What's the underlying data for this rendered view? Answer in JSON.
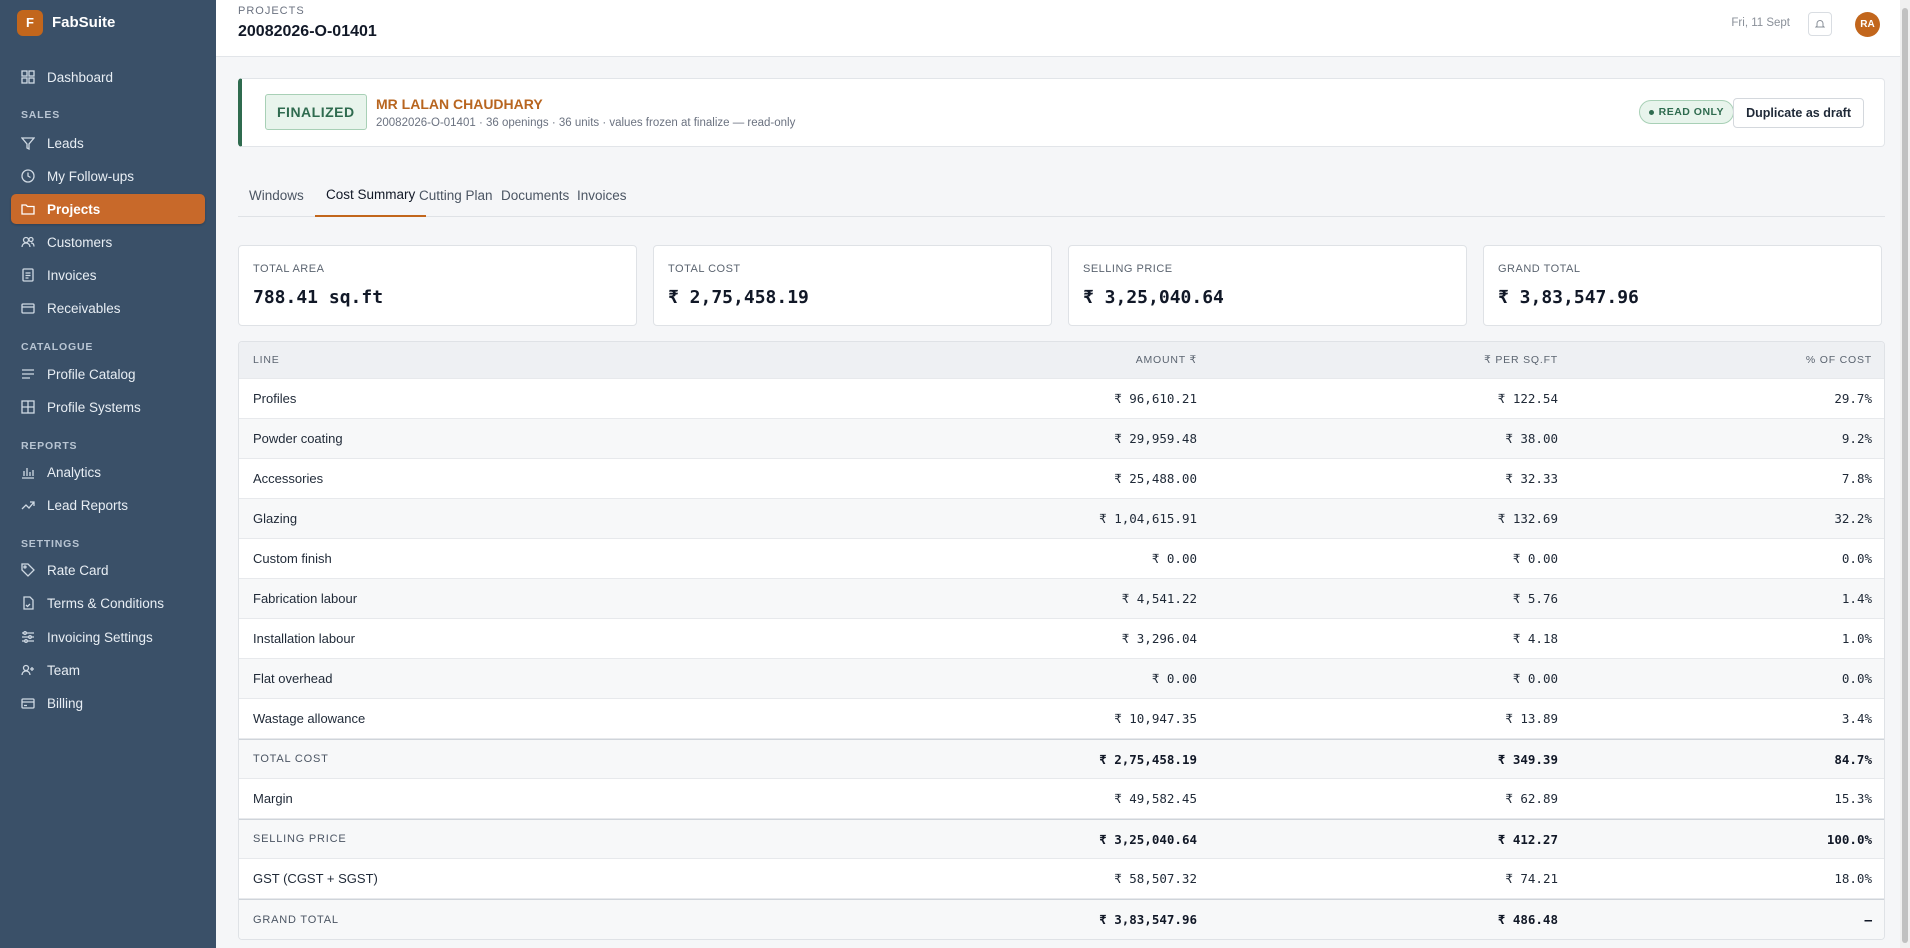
{
  "brand": {
    "initial": "F",
    "name": "FabSuite"
  },
  "sidebar": {
    "items": [
      {
        "label": "Dashboard",
        "icon": "grid-icon"
      },
      {
        "label": "Leads",
        "icon": "filter-icon"
      },
      {
        "label": "My Follow-ups",
        "icon": "clock-icon"
      },
      {
        "label": "Projects",
        "icon": "folder-icon"
      },
      {
        "label": "Customers",
        "icon": "users-icon"
      },
      {
        "label": "Invoices",
        "icon": "document-icon"
      },
      {
        "label": "Receivables",
        "icon": "wallet-icon"
      },
      {
        "label": "Profile Catalog",
        "icon": "stack-icon"
      },
      {
        "label": "Profile Systems",
        "icon": "window-icon"
      },
      {
        "label": "Analytics",
        "icon": "bar-chart-icon"
      },
      {
        "label": "Lead Reports",
        "icon": "trend-icon"
      },
      {
        "label": "Rate Card",
        "icon": "tag-icon"
      },
      {
        "label": "Terms & Conditions",
        "icon": "doc-sign-icon"
      },
      {
        "label": "Invoicing Settings",
        "icon": "sliders-icon"
      },
      {
        "label": "Team",
        "icon": "user-plus-icon"
      },
      {
        "label": "Billing",
        "icon": "card-icon"
      }
    ],
    "sections": [
      "SALES",
      "CATALOGUE",
      "REPORTS",
      "SETTINGS"
    ]
  },
  "header": {
    "breadcrumb": "PROJECTS",
    "title": "20082026-O-01401",
    "date": "Fri, 11 Sept",
    "avatar": "RA"
  },
  "banner": {
    "status": "FINALIZED",
    "client": "MR LALAN CHAUDHARY",
    "subtitle": "20082026-O-01401 · 36 openings · 36 units · values frozen at finalize — read-only",
    "badge": "READ ONLY",
    "duplicate_label": "Duplicate as draft"
  },
  "tabs": [
    "Windows",
    "Cost Summary",
    "Cutting Plan",
    "Documents",
    "Invoices"
  ],
  "active_tab": "Cost Summary",
  "kpis": [
    {
      "label": "TOTAL AREA",
      "value": "788.41 sq.ft"
    },
    {
      "label": "TOTAL COST",
      "value": "₹ 2,75,458.19"
    },
    {
      "label": "SELLING PRICE",
      "value": "₹ 3,25,040.64"
    },
    {
      "label": "GRAND TOTAL",
      "value": "₹ 3,83,547.96"
    }
  ],
  "table": {
    "headers": {
      "line": "LINE",
      "amount": "AMOUNT ₹",
      "per_sqft": "₹ PER SQ.FT",
      "pct": "% OF COST"
    },
    "rows": [
      {
        "line": "Profiles",
        "amount": "₹ 96,610.21",
        "per_sqft": "₹ 122.54",
        "pct": "29.7%"
      },
      {
        "line": "Powder coating",
        "amount": "₹ 29,959.48",
        "per_sqft": "₹ 38.00",
        "pct": "9.2%"
      },
      {
        "line": "Accessories",
        "amount": "₹ 25,488.00",
        "per_sqft": "₹ 32.33",
        "pct": "7.8%"
      },
      {
        "line": "Glazing",
        "amount": "₹ 1,04,615.91",
        "per_sqft": "₹ 132.69",
        "pct": "32.2%"
      },
      {
        "line": "Custom finish",
        "amount": "₹ 0.00",
        "per_sqft": "₹ 0.00",
        "pct": "0.0%"
      },
      {
        "line": "Fabrication labour",
        "amount": "₹ 4,541.22",
        "per_sqft": "₹ 5.76",
        "pct": "1.4%"
      },
      {
        "line": "Installation labour",
        "amount": "₹ 3,296.04",
        "per_sqft": "₹ 4.18",
        "pct": "1.0%"
      },
      {
        "line": "Flat overhead",
        "amount": "₹ 0.00",
        "per_sqft": "₹ 0.00",
        "pct": "0.0%"
      },
      {
        "line": "Wastage allowance",
        "amount": "₹ 10,947.35",
        "per_sqft": "₹ 13.89",
        "pct": "3.4%"
      },
      {
        "line": "TOTAL COST",
        "amount": "₹ 2,75,458.19",
        "per_sqft": "₹ 349.39",
        "pct": "84.7%",
        "total": true
      },
      {
        "line": "Margin",
        "amount": "₹ 49,582.45",
        "per_sqft": "₹ 62.89",
        "pct": "15.3%"
      },
      {
        "line": "SELLING PRICE",
        "amount": "₹ 3,25,040.64",
        "per_sqft": "₹ 412.27",
        "pct": "100.0%",
        "total": true
      },
      {
        "line": "GST (CGST + SGST)",
        "amount": "₹ 58,507.32",
        "per_sqft": "₹ 74.21",
        "pct": "18.0%"
      },
      {
        "line": "GRAND TOTAL",
        "amount": "₹ 3,83,547.96",
        "per_sqft": "₹ 486.48",
        "pct": "–",
        "total": true
      }
    ]
  },
  "colors": {
    "sidebar": "#3a5068",
    "accent": "#c2661c",
    "success": "#2f6b4f"
  }
}
